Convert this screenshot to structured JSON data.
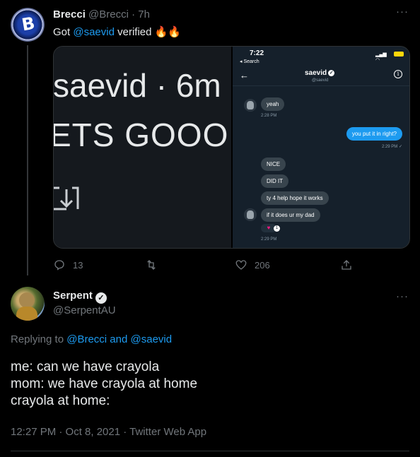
{
  "parent_tweet": {
    "author_name": "Brecci",
    "author_handle": "@Brecci",
    "sep": "·",
    "time": "7h",
    "text_prefix": "Got ",
    "mention": "@saevid",
    "text_suffix": " verified 🔥🔥",
    "more": "···",
    "media": {
      "left_line1": "saevid · 6m",
      "left_line2": "ETS GOOO",
      "dm": {
        "status_time": "7:22",
        "status_back": "◂ Search",
        "contact_name": "saevid",
        "contact_handle": "@saevid",
        "messages": [
          {
            "text": "yeah",
            "from": "them"
          },
          {
            "text": "2:28 PM",
            "kind": "time"
          },
          {
            "text": "you put it in right?",
            "from": "me"
          },
          {
            "text": "2:29 PM ✓",
            "kind": "time"
          },
          {
            "text": "NICE",
            "from": "them"
          },
          {
            "text": "DID IT",
            "from": "them"
          },
          {
            "text": "ty 4 help hope it works",
            "from": "them"
          },
          {
            "text": "if it does ur my dad",
            "from": "them"
          },
          {
            "text": "2:29 PM",
            "kind": "time"
          }
        ],
        "reaction_count": "1"
      }
    },
    "reply_count": "13",
    "like_count": "206"
  },
  "reply_tweet": {
    "author_name": "Serpent",
    "author_handle": "@SerpentAU",
    "more": "···",
    "replying_prefix": "Replying to ",
    "replying_user1": "@Brecci",
    "replying_and": " and ",
    "replying_user2": "@saevid",
    "lines": [
      "me: can we have crayola",
      "mom: we have crayola at home",
      "crayola at home:"
    ],
    "meta": "12:27 PM · Oct 8, 2021 · Twitter Web App"
  },
  "colors": {
    "background": "#000000",
    "accent": "#1d9bf0",
    "muted": "#71767b"
  }
}
